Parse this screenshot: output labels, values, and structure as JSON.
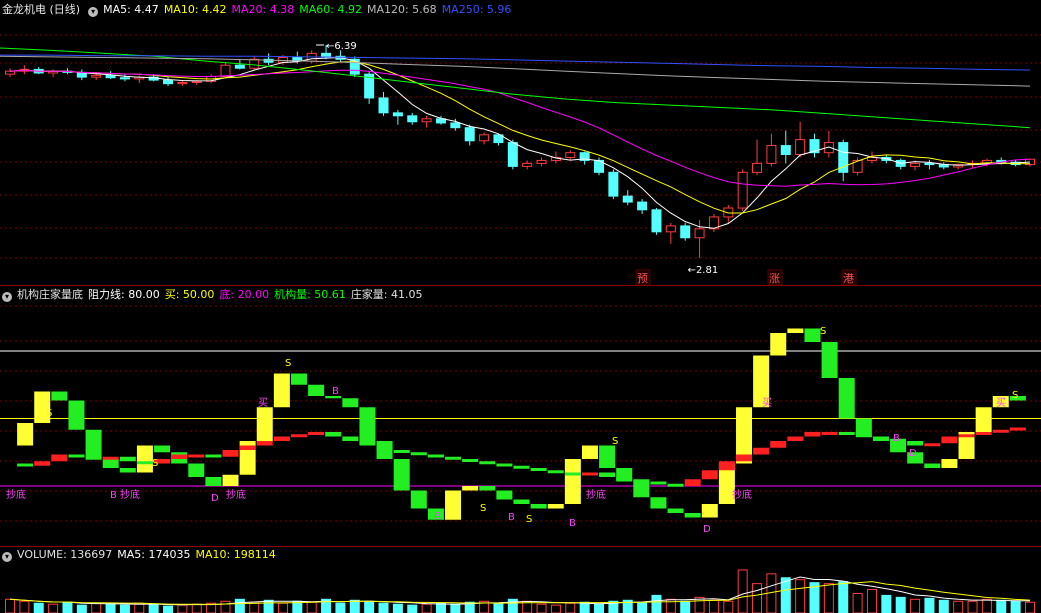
{
  "colors": {
    "up": "#ff3c3c",
    "down": "#54ffff",
    "ma5": "#ffffff",
    "ma10": "#ffff00",
    "ma20": "#ff00ff",
    "ma60": "#00ff00",
    "ma120": "#aaaaaa",
    "ma250": "#3050ff"
  },
  "main": {
    "title": "金龙机电 (日线)",
    "ma5": "MA5: 4.47",
    "ma10": "MA10: 4.42",
    "ma20": "MA20: 4.38",
    "ma60": "MA60: 4.92",
    "ma120": "MA120: 5.68",
    "ma250": "MA250: 5.96",
    "high_label": "6.39",
    "low_label": "2.81",
    "markers": [
      "预",
      "涨",
      "港"
    ]
  },
  "indicator": {
    "name": "机构庄家量底",
    "resistance": "阻力线: 80.00",
    "buy_line": "买: 50.00",
    "bottom_line": "底: 20.00",
    "inst_vol": "机构量: 50.61",
    "dealer_vol": "庄家量: 41.05",
    "tags": {
      "chaodi": "抄底",
      "b_chaodi": "B 抄底",
      "mai": "买",
      "s": "S",
      "b": "B",
      "bdi": "B 底",
      "d": "D"
    }
  },
  "volume": {
    "label": "VOLUME: 136697",
    "ma5": "MA5: 174035",
    "ma10": "MA10: 198114"
  },
  "chart_data": [
    {
      "type": "candlestick",
      "title": "金龙机电 (日线)",
      "annotations": [
        {
          "text": "6.39",
          "kind": "high"
        },
        {
          "text": "2.81",
          "kind": "low"
        }
      ],
      "ohlc": [
        [
          5.9,
          6.0,
          5.85,
          5.95
        ],
        [
          5.95,
          6.05,
          5.9,
          5.98
        ],
        [
          5.98,
          6.02,
          5.9,
          5.92
        ],
        [
          5.92,
          5.98,
          5.85,
          5.95
        ],
        [
          5.95,
          6.0,
          5.9,
          5.93
        ],
        [
          5.93,
          5.98,
          5.8,
          5.85
        ],
        [
          5.85,
          5.92,
          5.8,
          5.88
        ],
        [
          5.88,
          5.95,
          5.82,
          5.84
        ],
        [
          5.84,
          5.9,
          5.78,
          5.82
        ],
        [
          5.82,
          5.88,
          5.75,
          5.85
        ],
        [
          5.85,
          5.9,
          5.78,
          5.8
        ],
        [
          5.8,
          5.86,
          5.7,
          5.74
        ],
        [
          5.74,
          5.8,
          5.7,
          5.76
        ],
        [
          5.76,
          5.8,
          5.72,
          5.78
        ],
        [
          5.78,
          5.9,
          5.75,
          5.86
        ],
        [
          5.86,
          6.1,
          5.84,
          6.05
        ],
        [
          6.05,
          6.15,
          5.98,
          6.0
        ],
        [
          6.0,
          6.2,
          5.98,
          6.15
        ],
        [
          6.15,
          6.25,
          6.05,
          6.1
        ],
        [
          6.1,
          6.22,
          6.05,
          6.18
        ],
        [
          6.18,
          6.28,
          6.08,
          6.12
        ],
        [
          6.12,
          6.3,
          6.08,
          6.25
        ],
        [
          6.25,
          6.39,
          6.15,
          6.2
        ],
        [
          6.2,
          6.3,
          6.1,
          6.15
        ],
        [
          6.15,
          6.2,
          5.85,
          5.9
        ],
        [
          5.9,
          5.95,
          5.4,
          5.5
        ],
        [
          5.5,
          5.6,
          5.2,
          5.25
        ],
        [
          5.25,
          5.3,
          5.05,
          5.2
        ],
        [
          5.2,
          5.25,
          5.05,
          5.1
        ],
        [
          5.1,
          5.2,
          5.0,
          5.15
        ],
        [
          5.15,
          5.2,
          5.05,
          5.08
        ],
        [
          5.08,
          5.15,
          4.95,
          5.0
        ],
        [
          5.0,
          5.05,
          4.7,
          4.78
        ],
        [
          4.78,
          4.92,
          4.72,
          4.88
        ],
        [
          4.88,
          4.9,
          4.7,
          4.75
        ],
        [
          4.75,
          4.8,
          4.3,
          4.35
        ],
        [
          4.35,
          4.45,
          4.3,
          4.4
        ],
        [
          4.4,
          4.5,
          4.35,
          4.45
        ],
        [
          4.45,
          4.6,
          4.4,
          4.5
        ],
        [
          4.5,
          4.62,
          4.45,
          4.58
        ],
        [
          4.58,
          4.6,
          4.38,
          4.45
        ],
        [
          4.45,
          4.5,
          4.2,
          4.25
        ],
        [
          4.25,
          4.3,
          3.8,
          3.85
        ],
        [
          3.85,
          3.95,
          3.7,
          3.75
        ],
        [
          3.75,
          3.8,
          3.55,
          3.62
        ],
        [
          3.62,
          3.65,
          3.2,
          3.25
        ],
        [
          3.25,
          3.4,
          3.05,
          3.35
        ],
        [
          3.35,
          3.4,
          3.1,
          3.15
        ],
        [
          3.15,
          3.45,
          2.81,
          3.3
        ],
        [
          3.3,
          3.55,
          3.25,
          3.5
        ],
        [
          3.5,
          3.7,
          3.4,
          3.65
        ],
        [
          3.65,
          4.3,
          3.6,
          4.25
        ],
        [
          4.25,
          4.8,
          4.2,
          4.4
        ],
        [
          4.4,
          4.9,
          4.35,
          4.7
        ],
        [
          4.7,
          4.95,
          4.4,
          4.55
        ],
        [
          4.55,
          5.1,
          4.5,
          4.8
        ],
        [
          4.8,
          4.9,
          4.5,
          4.58
        ],
        [
          4.58,
          4.95,
          4.5,
          4.75
        ],
        [
          4.75,
          4.8,
          4.1,
          4.25
        ],
        [
          4.25,
          4.5,
          4.2,
          4.45
        ],
        [
          4.45,
          4.6,
          4.4,
          4.5
        ],
        [
          4.5,
          4.55,
          4.4,
          4.45
        ],
        [
          4.45,
          4.48,
          4.3,
          4.35
        ],
        [
          4.35,
          4.45,
          4.28,
          4.4
        ],
        [
          4.4,
          4.46,
          4.3,
          4.38
        ],
        [
          4.38,
          4.42,
          4.3,
          4.34
        ],
        [
          4.34,
          4.4,
          4.3,
          4.38
        ],
        [
          4.38,
          4.45,
          4.32,
          4.4
        ],
        [
          4.4,
          4.48,
          4.35,
          4.45
        ],
        [
          4.45,
          4.5,
          4.38,
          4.42
        ],
        [
          4.42,
          4.46,
          4.35,
          4.38
        ],
        [
          4.38,
          4.48,
          4.35,
          4.47
        ]
      ]
    }
  ]
}
